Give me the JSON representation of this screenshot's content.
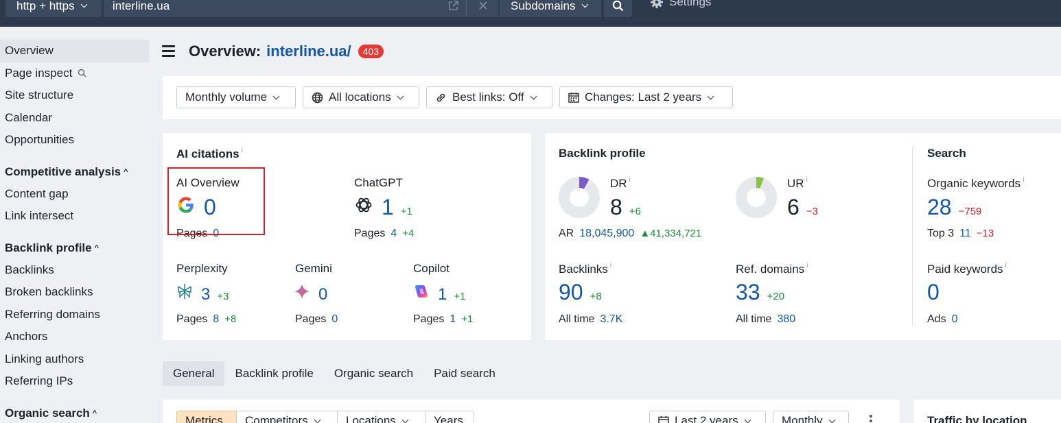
{
  "topbar": {
    "protocol": "http + https",
    "url_value": "interline.ua",
    "mode": "Subdomains",
    "settings": "Settings"
  },
  "sidebar": {
    "items_top": [
      "Overview",
      "Page inspect",
      "Site structure",
      "Calendar",
      "Opportunities"
    ],
    "competitive": {
      "heading": "Competitive analysis",
      "items": [
        "Content gap",
        "Link intersect"
      ]
    },
    "backlink": {
      "heading": "Backlink profile",
      "items": [
        "Backlinks",
        "Broken backlinks",
        "Referring domains",
        "Anchors",
        "Linking authors",
        "Referring IPs"
      ]
    },
    "organic": {
      "heading": "Organic search"
    }
  },
  "header": {
    "title_prefix": "Overview:",
    "domain": "interline.ua/",
    "badge": "403"
  },
  "filters": {
    "volume": "Monthly volume",
    "locations": "All locations",
    "best_links": "Best links: Off",
    "changes": "Changes: Last 2 years"
  },
  "ai_citations": {
    "title": "AI citations",
    "info": "i",
    "pages_label": "Pages",
    "ai_overview": {
      "label": "AI Overview",
      "value": "0",
      "pages": "0"
    },
    "chatgpt": {
      "label": "ChatGPT",
      "value": "1",
      "delta": "+1",
      "pages": "4",
      "pages_delta": "+4"
    },
    "perplexity": {
      "label": "Perplexity",
      "value": "3",
      "delta": "+3",
      "pages": "8",
      "pages_delta": "+8"
    },
    "gemini": {
      "label": "Gemini",
      "value": "0",
      "pages": "0"
    },
    "copilot": {
      "label": "Copilot",
      "value": "1",
      "delta": "+1",
      "pages": "1",
      "pages_delta": "+1"
    }
  },
  "backlink_profile": {
    "title": "Backlink profile",
    "dr": {
      "label": "DR",
      "value": "8",
      "delta": "+6",
      "gauge_fraction": 0.08
    },
    "ur": {
      "label": "UR",
      "value": "6",
      "delta": "−3",
      "gauge_fraction": 0.06
    },
    "ar": {
      "label": "AR",
      "value": "18,045,900",
      "delta": "41,334,721"
    },
    "backlinks": {
      "label": "Backlinks",
      "value": "90",
      "delta": "+8",
      "sub_label": "All time",
      "sub_value": "3.7K"
    },
    "ref_domains": {
      "label": "Ref. domains",
      "value": "33",
      "delta": "+20",
      "sub_label": "All time",
      "sub_value": "380"
    }
  },
  "search": {
    "title": "Search",
    "organic": {
      "label": "Organic keywords",
      "value": "28",
      "delta": "−759",
      "sub_label": "Top 3",
      "sub_value": "11",
      "sub_delta": "−13"
    },
    "paid": {
      "label": "Paid keywords",
      "value": "0",
      "sub_label": "Ads",
      "sub_value": "0"
    }
  },
  "tabs": [
    "General",
    "Backlink profile",
    "Organic search",
    "Paid search"
  ],
  "bottom": {
    "segments": [
      "Metrics",
      "Competitors",
      "Locations",
      "Years"
    ],
    "period": "Last 2 years",
    "granularity": "Monthly",
    "right_title": "Traffic by location"
  },
  "colors": {
    "topbar": "#2d3a4e",
    "link_blue": "#1557a4",
    "positive": "#1e8a3c",
    "negative": "#d0202b",
    "dr_gauge": "#7b5bc7",
    "ur_gauge": "#8bc34a"
  }
}
